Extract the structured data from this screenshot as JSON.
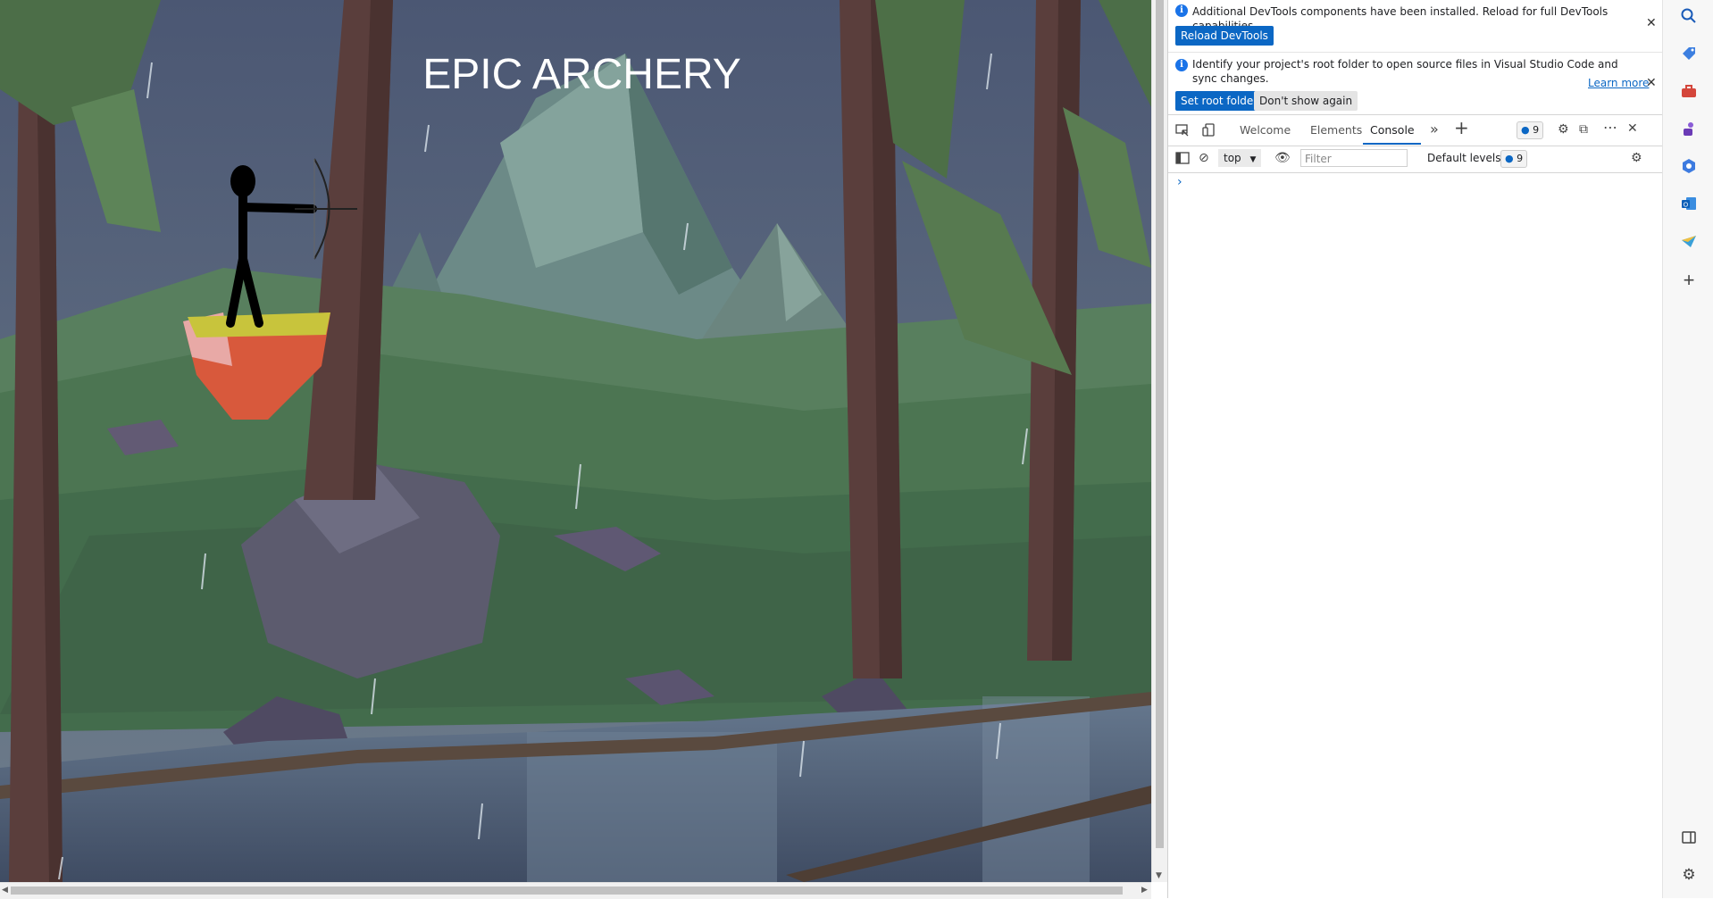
{
  "game": {
    "title": "EPIC ARCHERY"
  },
  "devtools": {
    "notice1": {
      "text": "Additional DevTools components have been installed. Reload for full DevTools capabilities.",
      "button": "Reload DevTools"
    },
    "notice2": {
      "text_line1": "Identify your project's root folder to open source files in Visual Studio Code and",
      "text_line2": "sync changes.",
      "learn_more": "Learn more",
      "primary_button": "Set root folder",
      "secondary_button": "Don't show again"
    },
    "tabs": [
      "Welcome",
      "Elements",
      "Console"
    ],
    "active_tab": "Console",
    "issues_count": "9",
    "console_toolbar": {
      "context": "top",
      "filter_placeholder": "Filter",
      "levels": "Default levels",
      "issues_count": "9"
    },
    "prompt": "›"
  },
  "colors": {
    "accent": "#0b67c4",
    "sky": "#4e5a72",
    "grass": "#4f7a52"
  }
}
